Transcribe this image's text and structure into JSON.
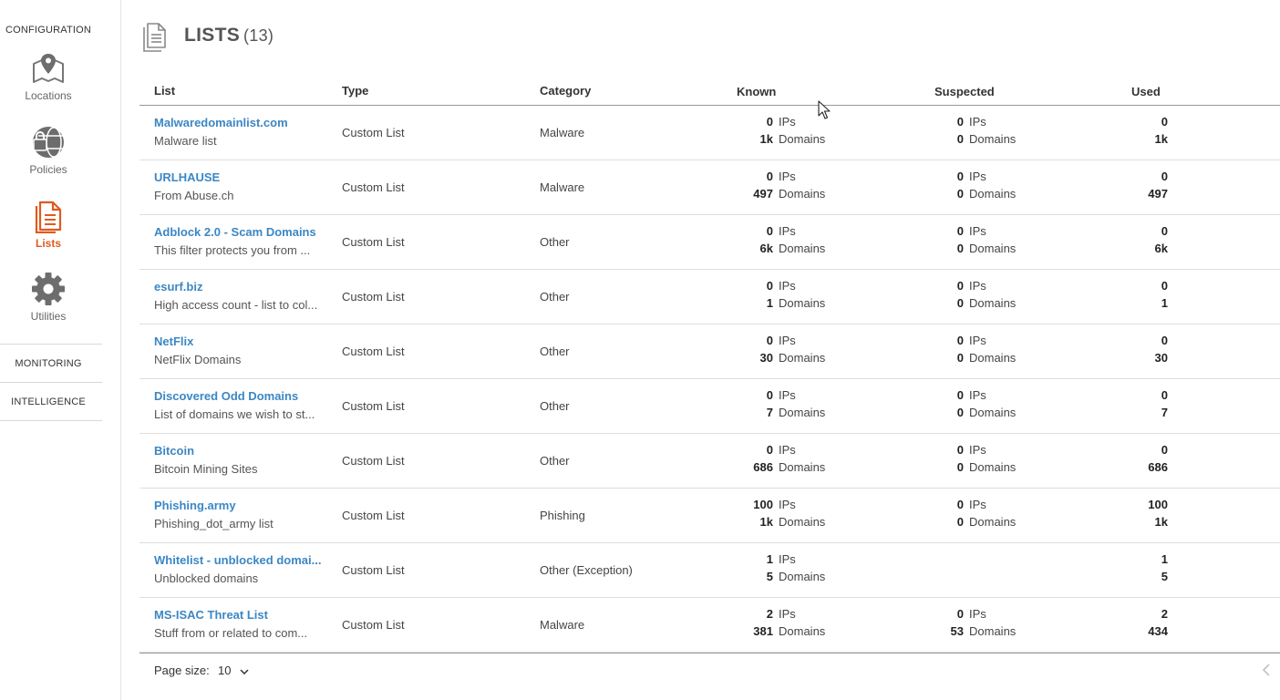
{
  "sidebar": {
    "configuration_title": "CONFIGURATION",
    "items": [
      {
        "label": "Locations",
        "icon": "map-pin-icon"
      },
      {
        "label": "Policies",
        "icon": "locked-globe-icon"
      },
      {
        "label": "Lists",
        "icon": "document-icon",
        "active": true
      },
      {
        "label": "Utilities",
        "icon": "gear-icon"
      }
    ],
    "monitoring_title": "MONITORING",
    "intelligence_title": "INTELLIGENCE"
  },
  "header": {
    "title": "LISTS",
    "count": "(13)",
    "icon": "document-icon"
  },
  "table": {
    "columns": {
      "list": "List",
      "type": "Type",
      "category": "Category",
      "known": "Known",
      "suspected": "Suspected",
      "used": "Used"
    },
    "units": {
      "ips": "IPs",
      "domains": "Domains"
    },
    "rows": [
      {
        "name": "Malwaredomainlist.com",
        "desc": "Malware list",
        "type": "Custom List",
        "category": "Malware",
        "known_ips": "0",
        "known_domains": "1k",
        "susp_ips": "0",
        "susp_domains": "0",
        "used_ips": "0",
        "used_domains": "1k"
      },
      {
        "name": "URLHAUSE",
        "desc": "From Abuse.ch",
        "type": "Custom List",
        "category": "Malware",
        "known_ips": "0",
        "known_domains": "497",
        "susp_ips": "0",
        "susp_domains": "0",
        "used_ips": "0",
        "used_domains": "497"
      },
      {
        "name": "Adblock 2.0 - Scam Domains",
        "desc": "This filter protects you from ...",
        "type": "Custom List",
        "category": "Other",
        "known_ips": "0",
        "known_domains": "6k",
        "susp_ips": "0",
        "susp_domains": "0",
        "used_ips": "0",
        "used_domains": "6k"
      },
      {
        "name": "esurf.biz",
        "desc": "High access count - list to col...",
        "type": "Custom List",
        "category": "Other",
        "known_ips": "0",
        "known_domains": "1",
        "susp_ips": "0",
        "susp_domains": "0",
        "used_ips": "0",
        "used_domains": "1"
      },
      {
        "name": "NetFlix",
        "desc": "NetFlix Domains",
        "type": "Custom List",
        "category": "Other",
        "known_ips": "0",
        "known_domains": "30",
        "susp_ips": "0",
        "susp_domains": "0",
        "used_ips": "0",
        "used_domains": "30"
      },
      {
        "name": "Discovered Odd Domains",
        "desc": "List of domains we wish to st...",
        "type": "Custom List",
        "category": "Other",
        "known_ips": "0",
        "known_domains": "7",
        "susp_ips": "0",
        "susp_domains": "0",
        "used_ips": "0",
        "used_domains": "7"
      },
      {
        "name": "Bitcoin",
        "desc": "Bitcoin Mining Sites",
        "type": "Custom List",
        "category": "Other",
        "known_ips": "0",
        "known_domains": "686",
        "susp_ips": "0",
        "susp_domains": "0",
        "used_ips": "0",
        "used_domains": "686"
      },
      {
        "name": "Phishing.army",
        "desc": "Phishing_dot_army list",
        "type": "Custom List",
        "category": "Phishing",
        "known_ips": "100",
        "known_domains": "1k",
        "susp_ips": "0",
        "susp_domains": "0",
        "used_ips": "100",
        "used_domains": "1k"
      },
      {
        "name": "Whitelist - unblocked domai...",
        "desc": "Unblocked domains",
        "type": "Custom List",
        "category": "Other (Exception)",
        "known_ips": "1",
        "known_domains": "5",
        "susp_ips": "",
        "susp_domains": "",
        "used_ips": "1",
        "used_domains": "5"
      },
      {
        "name": "MS-ISAC Threat List",
        "desc": "Stuff from or related to com...",
        "type": "Custom List",
        "category": "Malware",
        "known_ips": "2",
        "known_domains": "381",
        "susp_ips": "0",
        "susp_domains": "53",
        "used_ips": "2",
        "used_domains": "434"
      }
    ]
  },
  "footer": {
    "page_size_label": "Page size:",
    "page_size_value": "10"
  },
  "colors": {
    "accent": "#e05a1e",
    "link": "#3b87c4"
  }
}
